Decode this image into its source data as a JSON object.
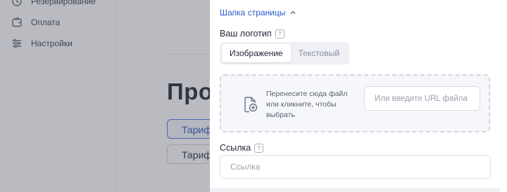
{
  "sidebar": {
    "items": [
      {
        "label": "Резервирование",
        "icon": "history-icon"
      },
      {
        "label": "Оплата",
        "icon": "wallet-icon"
      },
      {
        "label": "Настройки",
        "icon": "sliders-icon"
      }
    ]
  },
  "background": {
    "title": "Про",
    "tabs": [
      {
        "label": "Тариф"
      },
      {
        "label": "Тариф"
      }
    ]
  },
  "drawer": {
    "section_title": "Шапка страницы",
    "logo": {
      "label": "Ваш логотип",
      "help": "?",
      "toggle": {
        "options": [
          "Изображение",
          "Текстовый"
        ],
        "selected": "Изображение"
      },
      "dropzone_text": "Перенесите сюда файл или кликните, чтобы выбрать",
      "url_placeholder": "Или введите URL файла"
    },
    "link": {
      "label": "Ссылка",
      "help": "?",
      "placeholder": "Ссылка"
    }
  },
  "colors": {
    "accent": "#2a5bc9",
    "overlay": "rgba(90,94,104,0.42)"
  }
}
